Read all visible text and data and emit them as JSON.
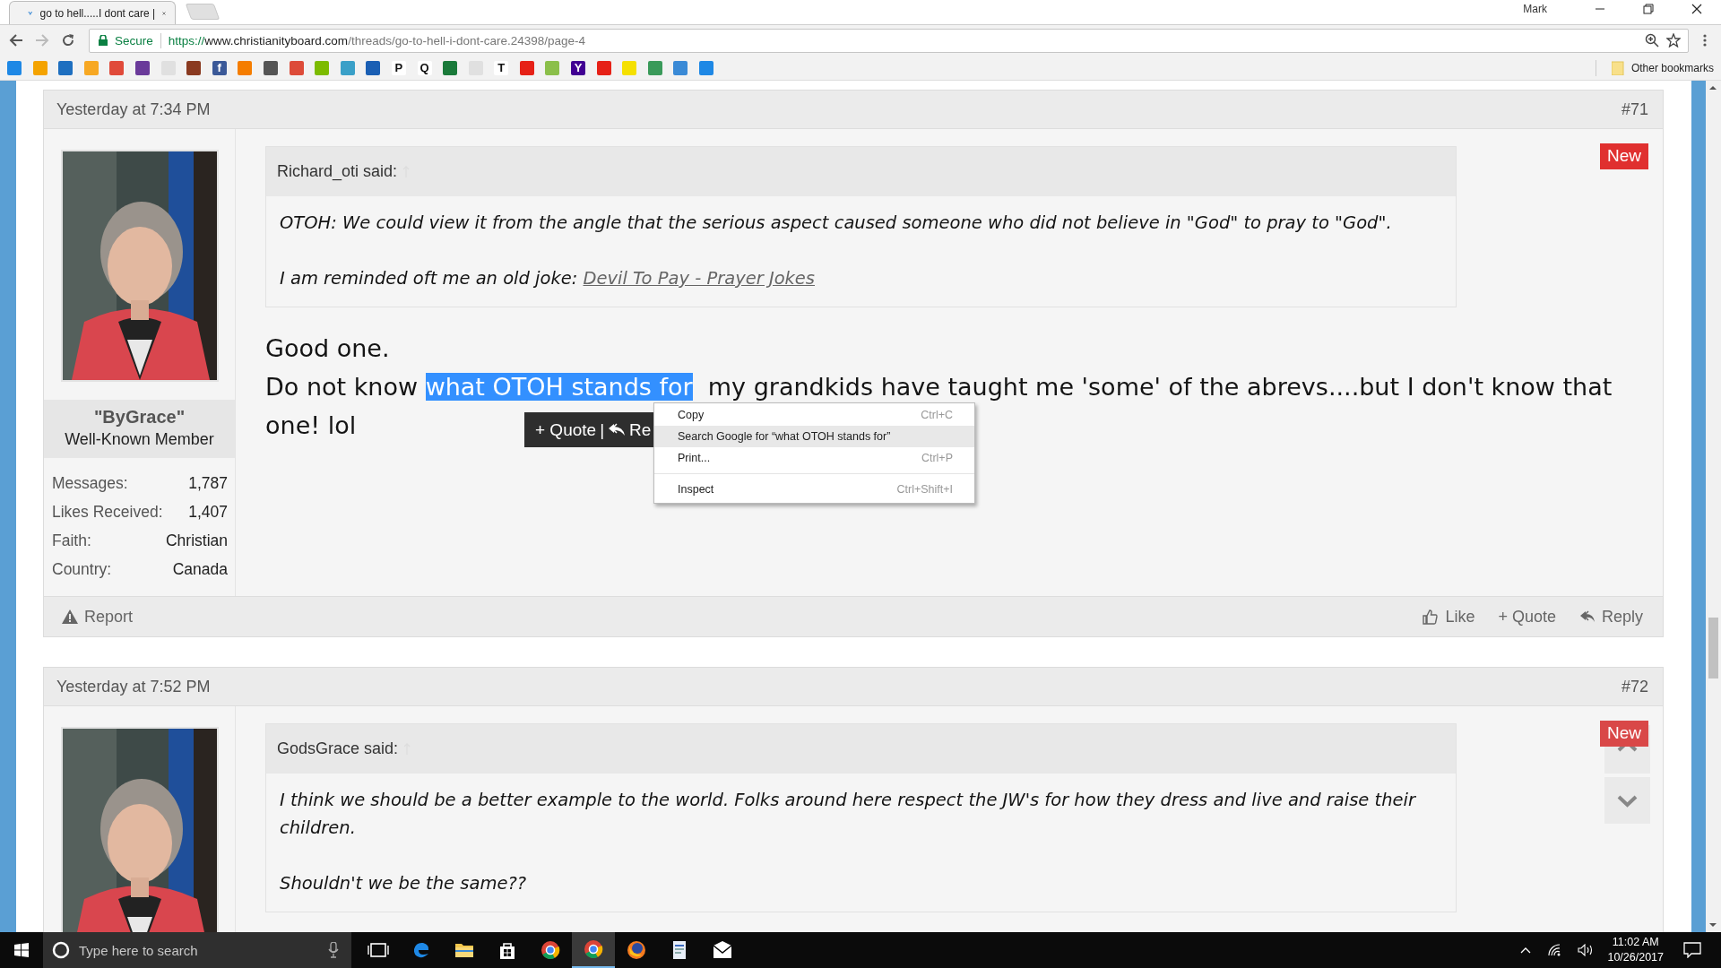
{
  "browser": {
    "tab": {
      "title": "go to hell.....I dont care |"
    },
    "profile": "Mark",
    "address": {
      "security": "Secure",
      "scheme": "https://",
      "host": "www.christianityboard.com",
      "path": "/threads/go-to-hell-i-dont-care.24398/page-4"
    },
    "bookmarks": [
      {
        "color": "#1e88e5"
      },
      {
        "color": "#f4a300"
      },
      {
        "color": "#1e6fc0"
      },
      {
        "color": "#f7a823"
      },
      {
        "color": "#e04a3a"
      },
      {
        "color": "#6a3a9a"
      },
      {
        "color": "#e0e0e0"
      },
      {
        "color": "#8a3a20"
      },
      {
        "color": "#3b5998",
        "glyph": "f"
      },
      {
        "color": "#f57d00"
      },
      {
        "color": "#555555"
      },
      {
        "color": "#dd4b39"
      },
      {
        "color": "#7cbb00"
      },
      {
        "color": "#3aa0c8"
      },
      {
        "color": "#1a5fb4"
      },
      {
        "color": "#ffffff",
        "glyph": "P"
      },
      {
        "color": "#ffffff",
        "glyph": "Q"
      },
      {
        "color": "#1a7a3a"
      },
      {
        "color": "#e0e0e0"
      },
      {
        "color": "#ffffff",
        "glyph": "T"
      },
      {
        "color": "#e62117"
      },
      {
        "color": "#8bbf4a"
      },
      {
        "color": "#410093",
        "glyph": "Y"
      },
      {
        "color": "#e62117"
      },
      {
        "color": "#f5e000"
      },
      {
        "color": "#3a9a5a"
      },
      {
        "color": "#3a8ad6"
      },
      {
        "color": "#1e88e5"
      }
    ],
    "other_bookmarks": "Other bookmarks"
  },
  "posts": [
    {
      "date": "Yesterday at 7:34 PM",
      "number": "#71",
      "badge": {
        "label": "New",
        "faded": false
      },
      "author": {
        "name": "\"ByGrace\"",
        "title": "Well-Known Member",
        "stats": [
          {
            "label": "Messages:",
            "value": "1,787"
          },
          {
            "label": "Likes Received:",
            "value": "1,407"
          },
          {
            "label": "Faith:",
            "value": "Christian"
          },
          {
            "label": "Country:",
            "value": "Canada"
          }
        ]
      },
      "quote": {
        "author": "Richard_oti said:",
        "paragraphs": [
          [
            {
              "text": "OTOH: We could view it from the angle that the serious aspect caused someone who did not believe in \"God\" to pray to \"God\"."
            }
          ],
          [
            {
              "text": "I am reminded oft me an old joke: "
            },
            {
              "text": "Devil To Pay - Prayer Jokes",
              "kind": "link"
            }
          ]
        ]
      },
      "body": [
        [
          {
            "text": "Good one.",
            "selected": false
          }
        ],
        [
          {
            "text": "Do not know ",
            "selected": false
          },
          {
            "text": "what OTOH stands for",
            "selected": true
          },
          {
            "text": "  my grandkids have taught me 'some' of the abrevs....but I don't know that",
            "selected": false
          }
        ],
        [
          {
            "text": "one! lol",
            "selected": false
          }
        ]
      ],
      "footer": {
        "report": "Report",
        "actions": [
          {
            "kind": "like",
            "label": "Like"
          },
          {
            "kind": "quote",
            "label": "+ Quote"
          },
          {
            "kind": "reply",
            "label": "Reply"
          }
        ]
      }
    },
    {
      "date": "Yesterday at 7:52 PM",
      "number": "#72",
      "badge": {
        "label": "New",
        "faded": true
      },
      "quote": {
        "author": "GodsGrace said:",
        "paragraphs": [
          [
            {
              "text": "I think we should be a better example to the world. Folks around here respect the JW's for how they dress and live and raise their children."
            }
          ],
          [
            {
              "text": "Shouldn't we be the same??"
            }
          ]
        ]
      }
    }
  ],
  "quote_popup": {
    "quote": "+ Quote",
    "divider": "|",
    "reply": "Re"
  },
  "context_menu": [
    {
      "kind": "item",
      "label": "Copy",
      "shortcut": "Ctrl+C",
      "highlighted": false
    },
    {
      "kind": "item",
      "label": "Search Google for “what OTOH stands for”",
      "highlighted": true
    },
    {
      "kind": "item",
      "label": "Print...",
      "shortcut": "Ctrl+P",
      "highlighted": false
    },
    {
      "kind": "separator"
    },
    {
      "kind": "item",
      "label": "Inspect",
      "shortcut": "Ctrl+Shift+I",
      "highlighted": false
    }
  ],
  "taskbar": {
    "search_placeholder": "Type here to search",
    "apps": [
      {
        "kind": "taskview",
        "active": false
      },
      {
        "kind": "edge",
        "active": false
      },
      {
        "kind": "folder",
        "active": false
      },
      {
        "kind": "store",
        "active": false
      },
      {
        "kind": "chrome",
        "active": false
      },
      {
        "kind": "chrome",
        "active": true
      },
      {
        "kind": "firefox",
        "active": false
      },
      {
        "kind": "doc",
        "active": false
      },
      {
        "kind": "mail",
        "active": false
      }
    ],
    "time": "11:02 AM",
    "date": "10/26/2017"
  }
}
